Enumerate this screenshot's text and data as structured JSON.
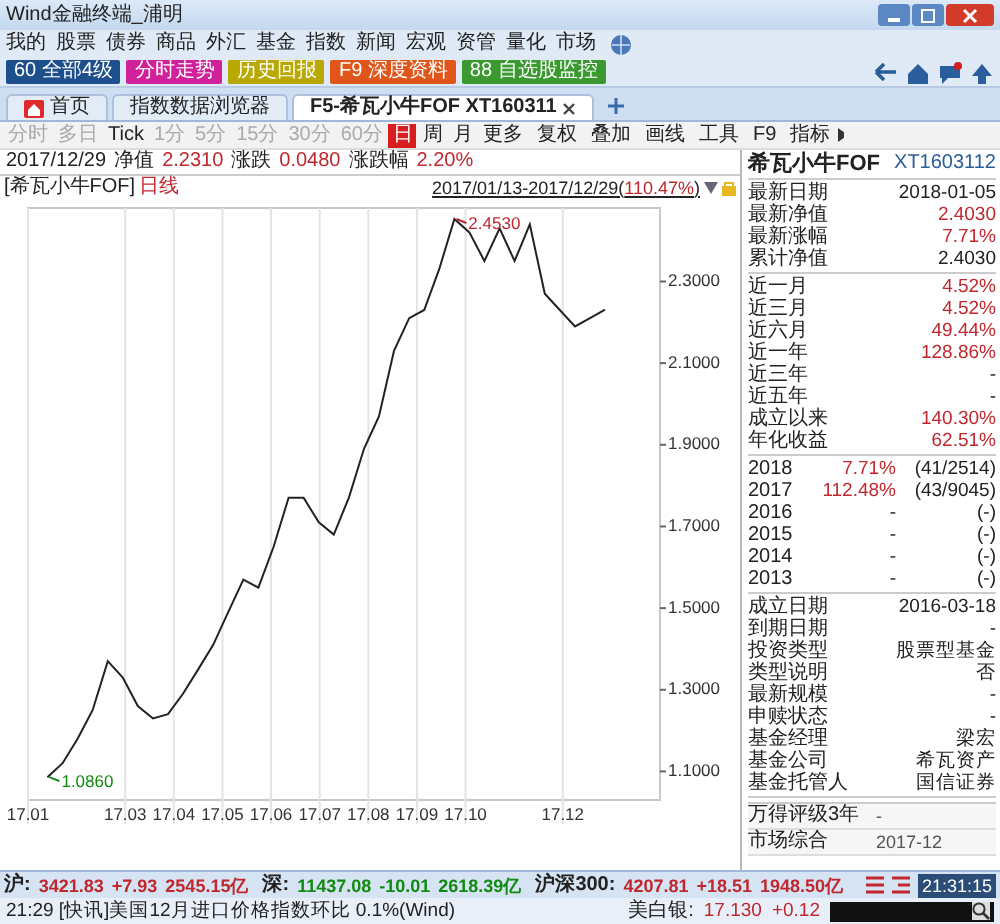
{
  "window": {
    "title": "Wind金融终端_浦明"
  },
  "menu": [
    "我的",
    "股票",
    "债券",
    "商品",
    "外汇",
    "基金",
    "指数",
    "新闻",
    "宏观",
    "资管",
    "量化",
    "市场"
  ],
  "quick_buttons": [
    {
      "label": "60 全部4级",
      "color": "#1d4f8c"
    },
    {
      "label": "分时走势",
      "color": "#d0209a"
    },
    {
      "label": "历史回报",
      "color": "#b8a800"
    },
    {
      "label": "F9 深度资料",
      "color": "#e0561a"
    },
    {
      "label": "88 自选股监控",
      "color": "#3a9a30"
    }
  ],
  "tabs": [
    {
      "label": "首页",
      "selected": false,
      "kind": "home"
    },
    {
      "label": "指数数据浏览器",
      "selected": false,
      "kind": "plain"
    },
    {
      "label": "F5-希瓦小牛FOF XT160311",
      "selected": true,
      "kind": "plain"
    }
  ],
  "periods": [
    {
      "label": "分时",
      "selected": false,
      "disabled": true
    },
    {
      "label": "多日",
      "selected": false,
      "disabled": true
    },
    {
      "label": "Tick",
      "selected": false,
      "disabled": false
    },
    {
      "label": "1分",
      "selected": false,
      "disabled": true
    },
    {
      "label": "5分",
      "selected": false,
      "disabled": true
    },
    {
      "label": "15分",
      "selected": false,
      "disabled": true
    },
    {
      "label": "30分",
      "selected": false,
      "disabled": true
    },
    {
      "label": "60分",
      "selected": false,
      "disabled": true
    },
    {
      "label": "日",
      "selected": true,
      "disabled": false
    },
    {
      "label": "周",
      "selected": false,
      "disabled": false
    },
    {
      "label": "月",
      "selected": false,
      "disabled": false
    },
    {
      "label": "更多",
      "selected": false,
      "disabled": false
    }
  ],
  "tools": [
    "复权",
    "叠加",
    "画线",
    "工具",
    "F9",
    "指标"
  ],
  "quote": {
    "date": "2017/12/29",
    "nav_label": "净值",
    "nav": "2.2310",
    "change_label": "涨跌",
    "change": "0.0480",
    "pct_label": "涨跌幅",
    "pct": "2.20%"
  },
  "chart": {
    "legend_period": "日线",
    "range_dates": "2017/01/13-2017/12/29(",
    "range_pct": "110.47%",
    "range_close": ")",
    "chart_data": {
      "type": "line",
      "x": [
        17.014,
        17.0171,
        17.0202,
        17.0233,
        17.0264,
        17.0295,
        17.0326,
        17.0357,
        17.0388,
        17.0419,
        17.045,
        17.0481,
        17.0512,
        17.0543,
        17.0574,
        17.0605,
        17.0636,
        17.0667,
        17.0698,
        17.0729,
        17.076,
        17.0791,
        17.0822,
        17.0853,
        17.0884,
        17.0915,
        17.0946,
        17.0977,
        17.1008,
        17.1039,
        17.107,
        17.1101,
        17.1132,
        17.1163,
        17.1194,
        17.1225,
        17.1256,
        17.1287
      ],
      "series": [
        {
          "name": "[希瓦小牛FOF]",
          "color": "#222222",
          "values": [
            1.086,
            1.12,
            1.18,
            1.25,
            1.37,
            1.33,
            1.26,
            1.23,
            1.24,
            1.29,
            1.35,
            1.41,
            1.49,
            1.57,
            1.55,
            1.65,
            1.77,
            1.77,
            1.71,
            1.68,
            1.77,
            1.89,
            1.97,
            2.13,
            2.21,
            2.23,
            2.33,
            2.453,
            2.42,
            2.35,
            2.43,
            2.35,
            2.44,
            2.27,
            2.23,
            2.19,
            2.21,
            2.231
          ]
        }
      ],
      "grid": true,
      "xlim": [
        17.01,
        17.14
      ],
      "ylim": [
        1.03,
        2.48
      ],
      "xticks": [
        {
          "value": 17.01,
          "label": "17.01"
        },
        {
          "value": 17.03,
          "label": "17.03"
        },
        {
          "value": 17.04,
          "label": "17.04"
        },
        {
          "value": 17.05,
          "label": "17.05"
        },
        {
          "value": 17.06,
          "label": "17.06"
        },
        {
          "value": 17.07,
          "label": "17.07"
        },
        {
          "value": 17.08,
          "label": "17.08"
        },
        {
          "value": 17.09,
          "label": "17.09"
        },
        {
          "value": 17.1,
          "label": "17.10"
        },
        {
          "value": 17.12,
          "label": "17.12"
        }
      ],
      "yticks": [
        {
          "value": 1.1,
          "label": "1.1000"
        },
        {
          "value": 1.3,
          "label": "1.3000"
        },
        {
          "value": 1.5,
          "label": "1.5000"
        },
        {
          "value": 1.7,
          "label": "1.7000"
        },
        {
          "value": 1.9,
          "label": "1.9000"
        },
        {
          "value": 2.1,
          "label": "2.1000"
        },
        {
          "value": 2.3,
          "label": "2.3000"
        }
      ],
      "annotations": [
        {
          "x": 17.0977,
          "y": 2.453,
          "text": "2.4530"
        },
        {
          "x": 17.014,
          "y": 1.086,
          "text": "1.0860"
        }
      ]
    }
  },
  "fund": {
    "name": "希瓦小牛FOF",
    "code": "XT1603112",
    "sections": [
      {
        "rows": [
          {
            "label": "最新日期",
            "value": "2018-01-05",
            "color": "#222222"
          },
          {
            "label": "最新净值",
            "value": "2.4030",
            "color": "#c0282e"
          },
          {
            "label": "最新涨幅",
            "value": "7.71%",
            "color": "#c0282e"
          },
          {
            "label": "累计净值",
            "value": "2.4030",
            "color": "#222222"
          }
        ]
      },
      {
        "rows": [
          {
            "label": "近一月",
            "value": "4.52%",
            "color": "#c0282e"
          },
          {
            "label": "近三月",
            "value": "4.52%",
            "color": "#c0282e"
          },
          {
            "label": "近六月",
            "value": "49.44%",
            "color": "#c0282e"
          },
          {
            "label": "近一年",
            "value": "128.86%",
            "color": "#c0282e"
          },
          {
            "label": "近三年",
            "value": "-"
          },
          {
            "label": "近五年",
            "value": "-"
          },
          {
            "label": "成立以来",
            "value": "140.30%",
            "color": "#c0282e"
          },
          {
            "label": "年化收益",
            "value": "62.51%",
            "color": "#c0282e"
          }
        ]
      },
      {
        "rows": [
          {
            "label": "2018",
            "value": "7.71%",
            "rank": "(41/2514)",
            "color": "#c0282e"
          },
          {
            "label": "2017",
            "value": "112.48%",
            "rank": "(43/9045)",
            "color": "#c0282e"
          },
          {
            "label": "2016",
            "value": "-",
            "rank": "(-)"
          },
          {
            "label": "2015",
            "value": "-",
            "rank": "(-)"
          },
          {
            "label": "2014",
            "value": "-",
            "rank": "(-)"
          },
          {
            "label": "2013",
            "value": "-",
            "rank": "(-)"
          }
        ]
      },
      {
        "rows": [
          {
            "label": "成立日期",
            "value": "2016-03-18",
            "color": "#222222"
          },
          {
            "label": "到期日期",
            "value": "-"
          },
          {
            "label": "投资类型",
            "value": "股票型基金",
            "color": "#222222"
          },
          {
            "label": "类型说明",
            "value": "否",
            "color": "#222222"
          },
          {
            "label": "最新规模",
            "value": "-"
          },
          {
            "label": "申赎状态",
            "value": "-"
          },
          {
            "label": "基金经理",
            "value": "梁宏",
            "color": "#222222"
          },
          {
            "label": "基金公司",
            "value": "希瓦资产",
            "color": "#222222"
          },
          {
            "label": "基金托管人",
            "value": "国信证券",
            "color": "#222222"
          }
        ]
      }
    ],
    "ratings": [
      {
        "label": "万得评级3年",
        "value": "-"
      },
      {
        "label": "市场综合",
        "value": "2017-12"
      }
    ]
  },
  "ticker": [
    {
      "name": "沪:",
      "price": "3421.83",
      "change": "+7.93",
      "amount": "2545.15亿",
      "color": "#c0282e"
    },
    {
      "name": "深:",
      "price": "11437.08",
      "change": "-10.01",
      "amount": "2618.39亿",
      "color": "#108a10"
    },
    {
      "name": "沪深300:",
      "price": "4207.81",
      "change": "+18.51",
      "amount": "1948.50亿",
      "color": "#c0282e"
    }
  ],
  "clock": "21:31:15",
  "news": "21:29 [快讯]美国12月进口价格指数环比 0.1%(Wind)",
  "silver": {
    "name": "美白银:",
    "price": "17.130",
    "change": "+0.12"
  }
}
